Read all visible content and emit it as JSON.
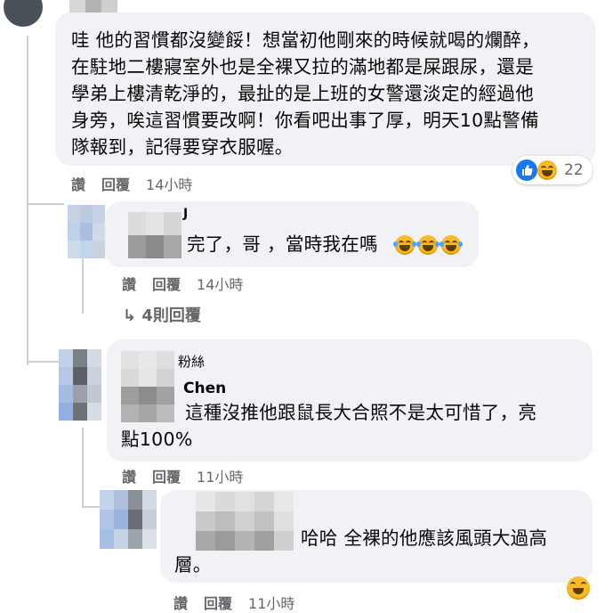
{
  "comments": [
    {
      "text_lines": [
        "哇 他的習慣都沒變餒！想當初他剛來的時候就喝的爛醉，",
        "在駐地二樓寢室外也是全裸又拉的滿地都是屎跟尿，還是",
        "學弟上樓清乾淨的，最扯的是上班的女警還淡定的經過他",
        "身旁，唉這習慣要改啊！你看吧出事了厚，明天10點警備",
        "隊報到，記得要穿衣服喔。"
      ],
      "reaction_count": "22",
      "actions": {
        "like": "讚",
        "reply": "回覆",
        "time": "14小時"
      }
    },
    {
      "name_fragment": "J",
      "text_lines": [
        "完了，哥 ，當時我在嗎"
      ],
      "actions": {
        "like": "讚",
        "reply": "回覆",
        "time": "14小時"
      },
      "more_replies": "↳ 4則回覆"
    },
    {
      "badge_fragment": "粉絲",
      "name_fragment": "Chen",
      "text_lines": [
        "這種沒推他跟鼠長大合照不是太可惜了，亮",
        "點100%"
      ],
      "actions": {
        "like": "讚",
        "reply": "回覆",
        "time": "11小時"
      }
    },
    {
      "text_lines": [
        "哈哈 全裸的他應該風頭大過高",
        "層。"
      ],
      "actions": {
        "like": "讚",
        "reply": "回覆",
        "time": "11小時"
      }
    }
  ],
  "colors": {
    "bubble": "#f0f2f5",
    "meta": "#65676b",
    "like_blue": "#1877f2",
    "haha_yellow": "#f7b928"
  },
  "icons": [
    "like-reaction-icon",
    "haha-reaction-icon",
    "laughing-emoji-icon",
    "reply-arrow-icon"
  ]
}
